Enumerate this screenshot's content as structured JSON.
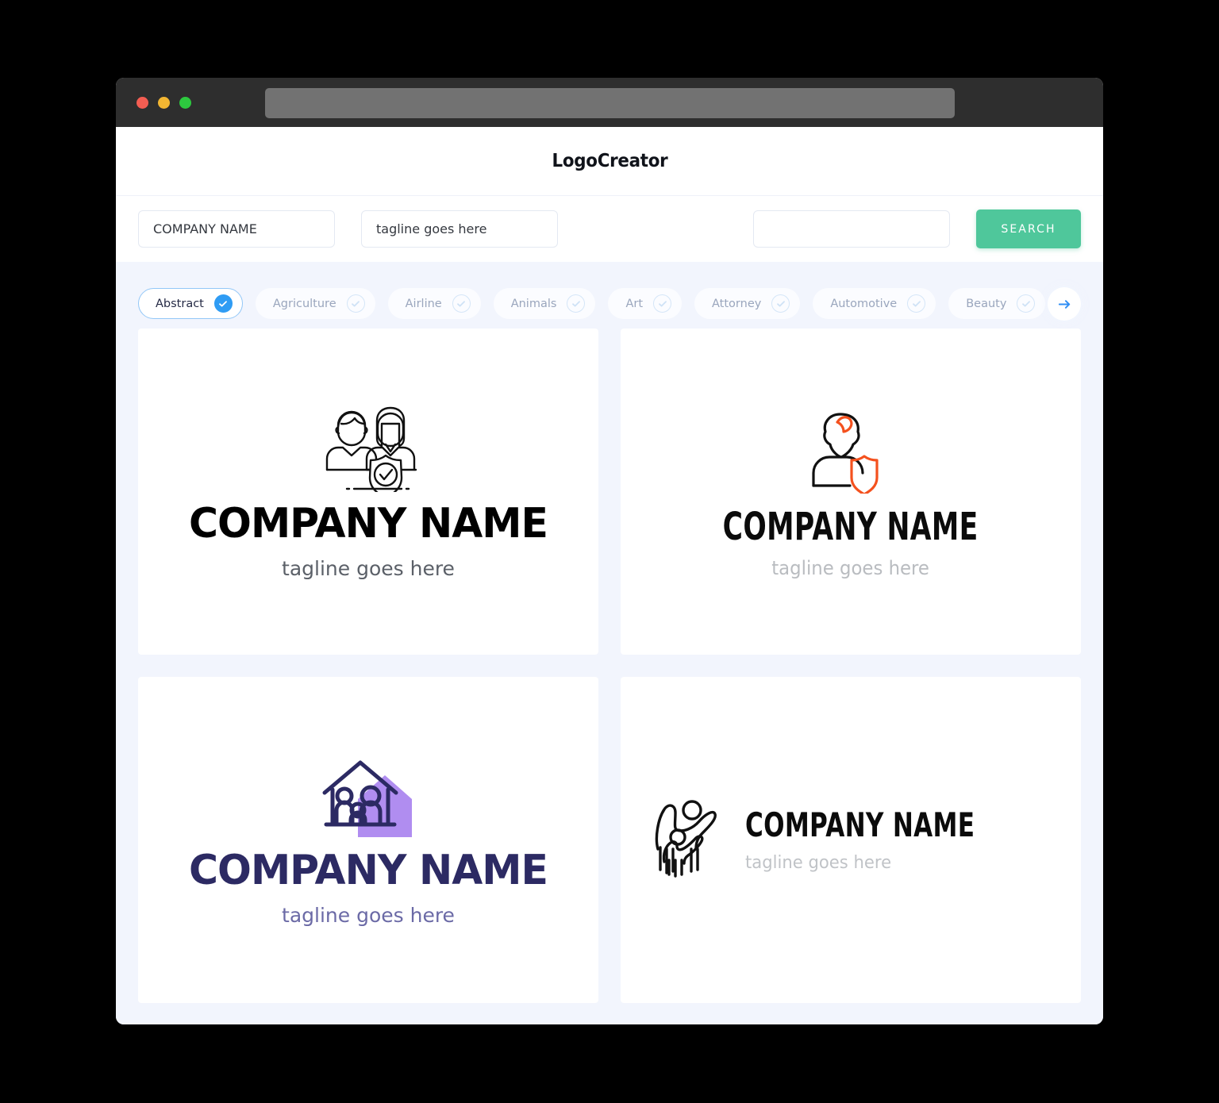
{
  "window": {
    "traffic_lights": [
      "close",
      "minimize",
      "maximize"
    ],
    "address_bar_value": ""
  },
  "header": {
    "brand": "LogoCreator"
  },
  "search": {
    "company_value": "COMPANY NAME",
    "company_placeholder": "COMPANY NAME",
    "tagline_value": "tagline goes here",
    "tagline_placeholder": "tagline goes here",
    "keyword_value": "",
    "keyword_placeholder": "",
    "search_button": "SEARCH",
    "button_color": "#4fc79b"
  },
  "categories": {
    "next_arrow_icon": "arrow-right-icon",
    "accent_color": "#2f9cf4",
    "items": [
      {
        "label": "Abstract",
        "selected": true
      },
      {
        "label": "Agriculture",
        "selected": false
      },
      {
        "label": "Airline",
        "selected": false
      },
      {
        "label": "Animals",
        "selected": false
      },
      {
        "label": "Art",
        "selected": false
      },
      {
        "label": "Attorney",
        "selected": false
      },
      {
        "label": "Automotive",
        "selected": false
      },
      {
        "label": "Beauty",
        "selected": false
      }
    ]
  },
  "results": [
    {
      "icon_name": "two-people-shield-check-icon",
      "name": "COMPANY NAME",
      "tagline": "tagline goes here",
      "name_color": "#000000",
      "tagline_color": "#5b6068",
      "accent_color": "#000000",
      "layout": "stacked"
    },
    {
      "icon_name": "person-with-shield-icon",
      "name": "COMPANY NAME",
      "tagline": "tagline goes here",
      "name_color": "#0b0b0b",
      "tagline_color": "#b9bcc0",
      "accent_color": "#f4511e",
      "layout": "stacked"
    },
    {
      "icon_name": "family-house-icon",
      "name": "COMPANY NAME",
      "tagline": "tagline goes here",
      "name_color": "#2c2a63",
      "tagline_color": "#6b6aa6",
      "accent_color": "#b08df0",
      "layout": "stacked"
    },
    {
      "icon_name": "family-raised-arms-icon",
      "name": "COMPANY NAME",
      "tagline": "tagline goes here",
      "name_color": "#0b0b0b",
      "tagline_color": "#c0c3c7",
      "accent_color": "#000000",
      "layout": "horizontal"
    }
  ]
}
